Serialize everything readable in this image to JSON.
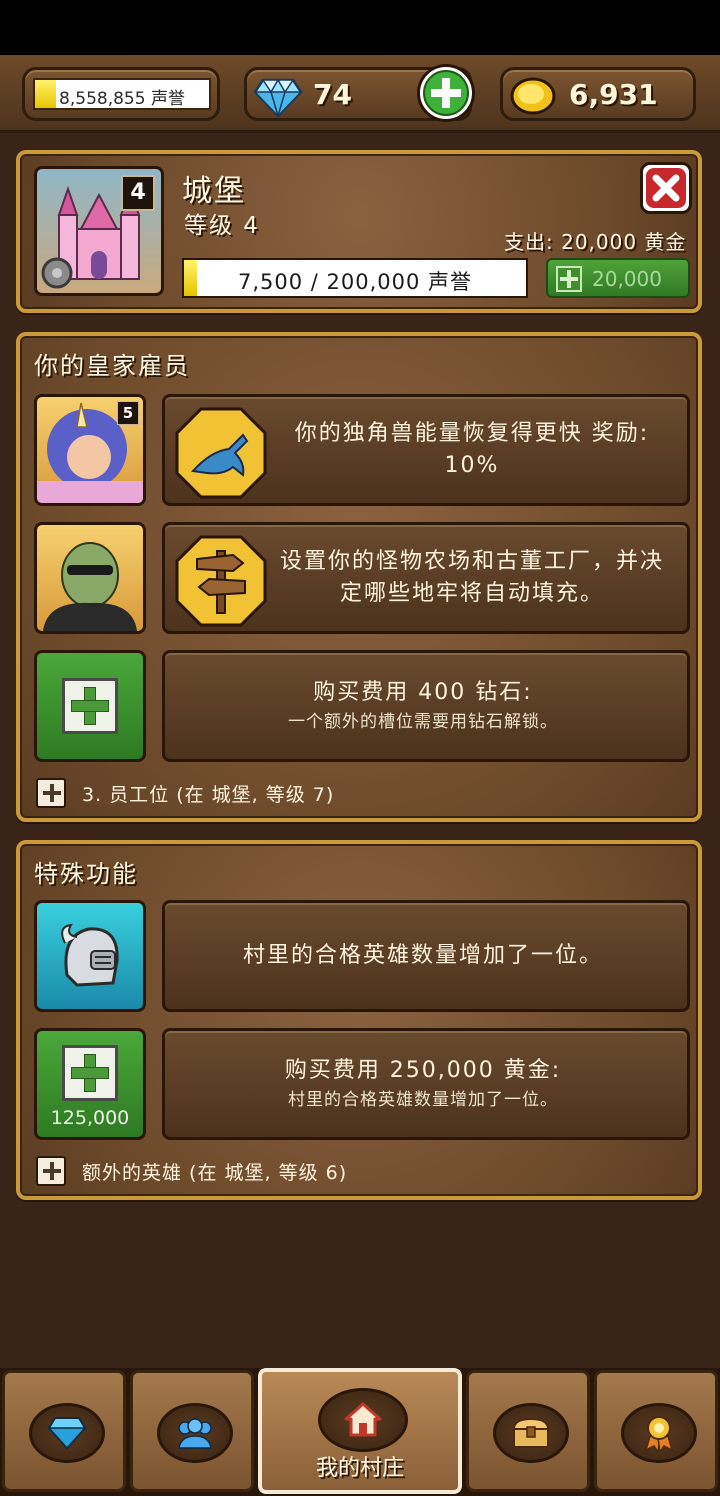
{
  "topbar": {
    "reputation_text": "8,558,855 声誉",
    "reputation_progress": 0.12,
    "gems": "74",
    "gold": "6,931"
  },
  "castle": {
    "name": "城堡",
    "level_label": "等级 4",
    "level_badge": "4",
    "cost_label": "支出: 20,000 黄金",
    "progress_text": "7,500 / 200,000 声誉",
    "progress": 0.0375,
    "upgrade_button": "20,000"
  },
  "royal_staff": {
    "title": "你的皇家雇员",
    "rows": [
      {
        "portrait_badge": "5",
        "perk_icon": "unicorn-icon",
        "text": "你的独角兽能量恢复得更快 奖励: 10%"
      },
      {
        "perk_icon": "signpost-icon",
        "text": "设置你的怪物农场和古董工厂，并决定哪些地牢将自动填充。"
      },
      {
        "buy_title": "购买费用 400 钻石:",
        "buy_sub": "一个额外的槽位需要用钻石解锁。"
      }
    ],
    "footer": "3. 员工位 (在 城堡, 等级 7)"
  },
  "special": {
    "title": "特殊功能",
    "rows": [
      {
        "icon": "knight-helmet-icon",
        "text": "村里的合格英雄数量增加了一位。"
      },
      {
        "price": "125,000",
        "buy_title": "购买费用 250,000 黄金:",
        "buy_sub": "村里的合格英雄数量增加了一位。"
      }
    ],
    "footer": "额外的英雄 (在 城堡, 等级 6)"
  },
  "bottom_nav": {
    "items": [
      {
        "icon": "gem-shop-icon"
      },
      {
        "icon": "heroes-icon"
      },
      {
        "icon": "home-icon",
        "label": "我的村庄"
      },
      {
        "icon": "treasure-chest-icon"
      },
      {
        "icon": "medal-icon"
      }
    ]
  },
  "colors": {
    "accent_gold": "#c89a3a",
    "wood": "#6d4a2b",
    "green": "#3f8f2a"
  }
}
